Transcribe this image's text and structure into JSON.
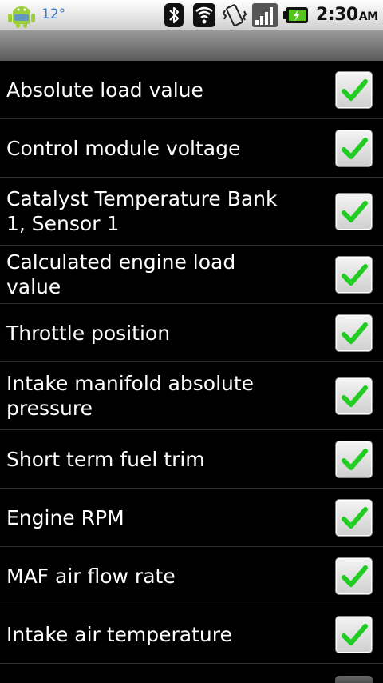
{
  "status_bar": {
    "temperature": "12°",
    "time": "2:30",
    "ampm": "AM",
    "icons": [
      "android-weather-icon",
      "bluetooth-icon",
      "wifi-icon",
      "vibrate-icon",
      "signal-icon",
      "battery-charging-icon"
    ]
  },
  "colors": {
    "background": "#000000",
    "check": "#22cc22",
    "temperature": "#3a78c2"
  },
  "list": {
    "items": [
      {
        "label": "Absolute load value",
        "checked": true
      },
      {
        "label": "Control module voltage",
        "checked": true
      },
      {
        "label": "Catalyst Temperature Bank 1, Sensor 1",
        "checked": true
      },
      {
        "label": "Calculated engine load value",
        "checked": true
      },
      {
        "label": "Throttle position",
        "checked": true
      },
      {
        "label": "Intake manifold absolute pressure",
        "checked": true
      },
      {
        "label": "Short term fuel trim",
        "checked": true
      },
      {
        "label": "Engine RPM",
        "checked": true
      },
      {
        "label": "MAF air flow rate",
        "checked": true
      },
      {
        "label": "Intake air temperature",
        "checked": true
      }
    ]
  }
}
